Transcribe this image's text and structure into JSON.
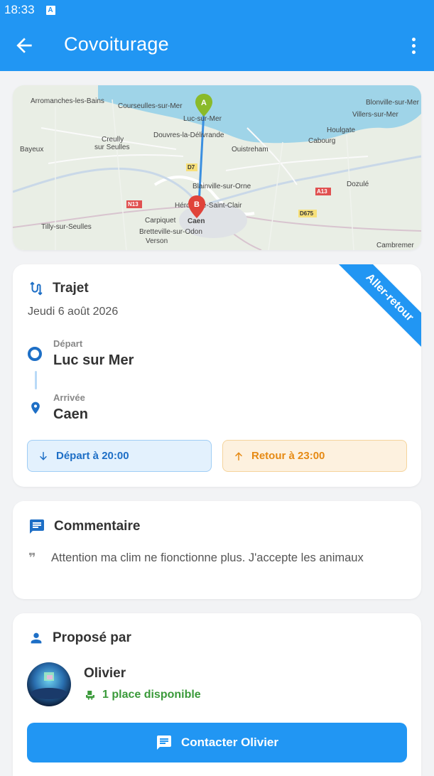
{
  "status_bar": {
    "time": "18:33",
    "notification_icon": "A"
  },
  "app_bar": {
    "title": "Covoiturage",
    "back_icon": "arrow-left-icon",
    "menu_icon": "more-vert-icon"
  },
  "map": {
    "places": [
      "Arromanches-les-Bains",
      "Courseulles-sur-Mer",
      "Luc-sur-Mer",
      "Blonville-sur-Mer",
      "Villers-sur-Mer",
      "Houlgate",
      "Cabourg",
      "Creully",
      "sur Seulles",
      "Douvres-la-Délivrande",
      "Ouistreham",
      "Bayeux",
      "Blainville-sur-Orne",
      "Dozulé",
      "Hérouville-Saint-Clair",
      "Carpiquet",
      "Caen",
      "Tilly-sur-Seulles",
      "Bretteville-sur-Odon",
      "Verson",
      "Cambremer"
    ],
    "roads": [
      "D7",
      "N13",
      "A13",
      "D675"
    ],
    "marker_start": "A",
    "marker_end": "B"
  },
  "trip": {
    "title": "Trajet",
    "date": "Jeudi 6 août 2026",
    "ribbon": "Aller-retour",
    "departure_label": "Départ",
    "departure_place": "Luc sur Mer",
    "arrival_label": "Arrivée",
    "arrival_place": "Caen",
    "departure_time": "Départ à 20:00",
    "return_time": "Retour à 23:00"
  },
  "comment": {
    "title": "Commentaire",
    "text": "Attention ma clim ne fionctionne plus. J'accepte les animaux"
  },
  "proposer": {
    "title": "Proposé par",
    "name": "Olivier",
    "seats": "1 place disponible",
    "contact_button": "Contacter Olivier"
  },
  "colors": {
    "primary": "#2196f3",
    "depart_blue": "#1e6fc6",
    "return_orange": "#e68a14",
    "seats_green": "#3a9a3a"
  }
}
